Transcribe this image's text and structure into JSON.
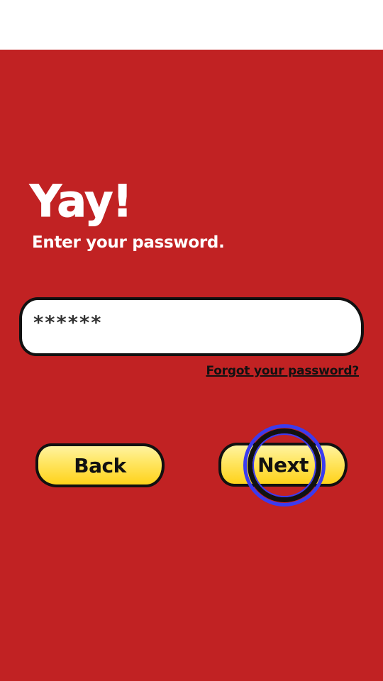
{
  "heading": "Yay!",
  "subheading": "Enter your password.",
  "password_field": {
    "value": "******"
  },
  "forgot_link": "Forgot your password?",
  "buttons": {
    "back": "Back",
    "next": "Next"
  },
  "colors": {
    "background": "#c12223",
    "top_bar": "#ffffff",
    "button_fill": "#ffd21a",
    "highlight_ring": "#3b3bf0",
    "text_light": "#ffffff",
    "text_dark": "#111111"
  }
}
